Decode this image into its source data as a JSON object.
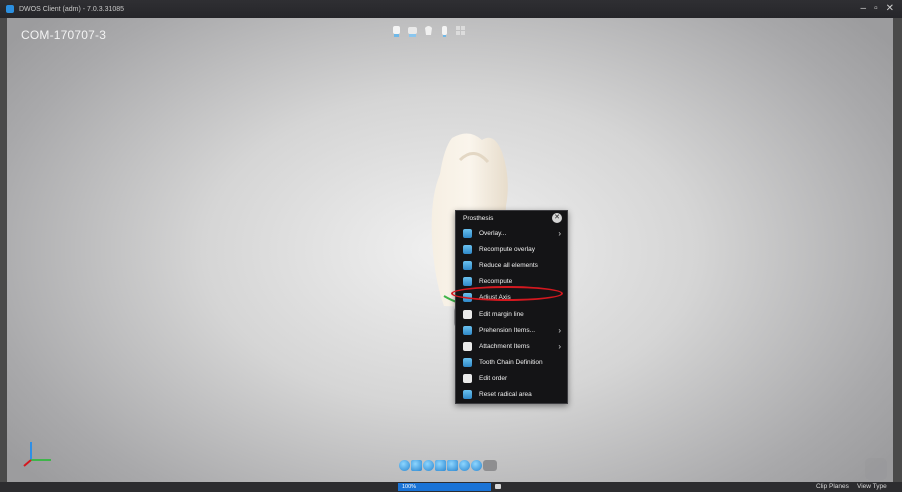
{
  "window": {
    "title": "DWOS Client (adm) - 7.0.3.31085",
    "controls": [
      "–",
      "▫",
      "✕"
    ]
  },
  "viewport": {
    "document_id": "COM-170707-3",
    "top_toolbar_icons": [
      "view-top-icon",
      "view-side-icon",
      "view-crown-icon",
      "view-profile-icon",
      "view-grid-icon"
    ]
  },
  "context_menu": {
    "title": "Prosthesis",
    "items": [
      {
        "label": "Overlay...",
        "icon": "overlay-icon",
        "submenu": true
      },
      {
        "label": "Recompute overlay",
        "icon": "recompute-overlay-icon",
        "submenu": false
      },
      {
        "label": "Reduce all elements",
        "icon": "reduce-elements-icon",
        "submenu": false
      },
      {
        "label": "Recompute",
        "icon": "recompute-icon",
        "submenu": false
      },
      {
        "label": "Adjust Axis",
        "icon": "adjust-axis-icon",
        "submenu": false
      },
      {
        "label": "Edit margin line",
        "icon": "margin-line-icon",
        "submenu": false
      },
      {
        "label": "Prehension Items...",
        "icon": "prehension-icon",
        "submenu": true
      },
      {
        "label": "Attachment Items",
        "icon": "attachment-icon",
        "submenu": true
      },
      {
        "label": "Tooth Chain Definition",
        "icon": "tooth-chain-icon",
        "submenu": false
      },
      {
        "label": "Edit order",
        "icon": "edit-order-icon",
        "submenu": false
      },
      {
        "label": "Reset radical area",
        "icon": "reset-area-icon",
        "submenu": false
      }
    ],
    "highlighted_item": "Adjust Axis",
    "highlight_color": "#d4181f"
  },
  "statusbar": {
    "progress_label": "100%",
    "progress_value": 1.0,
    "clip_planes": "Clip Planes",
    "view_type": "View Type"
  },
  "colors": {
    "accent": "#1a73d6",
    "menu_bg": "#141416",
    "highlight": "#d4181f"
  }
}
